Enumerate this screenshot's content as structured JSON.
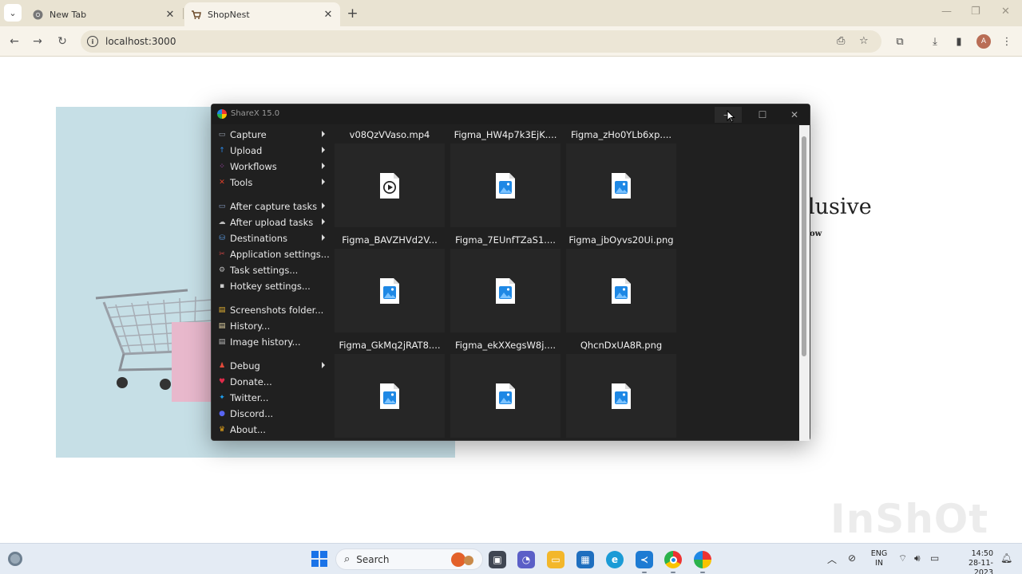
{
  "browser": {
    "tabs": [
      {
        "title": "New Tab",
        "icon": "chrome-icon"
      },
      {
        "title": "ShopNest",
        "icon": "shopnest-favicon",
        "active": true
      }
    ],
    "url": "localhost:3000",
    "avatar_letter": "A"
  },
  "page": {
    "heading_partial": "lusive",
    "subheading_partial": "ow",
    "watermark": "InShOt"
  },
  "sharex": {
    "title": "ShareX 15.0",
    "menu": [
      {
        "label": "Capture",
        "icon": "capture-icon",
        "submenu": true
      },
      {
        "label": "Upload",
        "icon": "upload-icon",
        "submenu": true
      },
      {
        "label": "Workflows",
        "icon": "workflows-icon",
        "submenu": true
      },
      {
        "label": "Tools",
        "icon": "tools-icon",
        "submenu": true
      },
      {
        "label": "After capture tasks",
        "icon": "after-capture-icon",
        "submenu": true
      },
      {
        "label": "After upload tasks",
        "icon": "after-upload-icon",
        "submenu": true
      },
      {
        "label": "Destinations",
        "icon": "destinations-icon",
        "submenu": true
      },
      {
        "label": "Application settings...",
        "icon": "app-settings-icon",
        "submenu": false
      },
      {
        "label": "Task settings...",
        "icon": "task-settings-icon",
        "submenu": false
      },
      {
        "label": "Hotkey settings...",
        "icon": "hotkey-settings-icon",
        "submenu": false
      },
      {
        "label": "Screenshots folder...",
        "icon": "folder-icon",
        "submenu": false
      },
      {
        "label": "History...",
        "icon": "history-icon",
        "submenu": false
      },
      {
        "label": "Image history...",
        "icon": "image-history-icon",
        "submenu": false
      },
      {
        "label": "Debug",
        "icon": "debug-icon",
        "submenu": true
      },
      {
        "label": "Donate...",
        "icon": "heart-icon",
        "submenu": false
      },
      {
        "label": "Twitter...",
        "icon": "twitter-icon",
        "submenu": false
      },
      {
        "label": "Discord...",
        "icon": "discord-icon",
        "submenu": false
      },
      {
        "label": "About...",
        "icon": "crown-icon",
        "submenu": false
      }
    ],
    "files": [
      {
        "name": "v08QzVVaso.mp4",
        "type": "video"
      },
      {
        "name": "Figma_HW4p7k3EjK....",
        "type": "image"
      },
      {
        "name": "Figma_zHo0YLb6xp....",
        "type": "image"
      },
      {
        "name": "Figma_BAVZHVd2V...",
        "type": "image"
      },
      {
        "name": "Figma_7EUnfTZaS1....",
        "type": "image"
      },
      {
        "name": "Figma_jbOyvs20Ui.png",
        "type": "image"
      },
      {
        "name": "Figma_GkMq2jRAT8....",
        "type": "image"
      },
      {
        "name": "Figma_ekXXegsW8j....",
        "type": "image"
      },
      {
        "name": "QhcnDxUA8R.png",
        "type": "image"
      }
    ]
  },
  "taskbar": {
    "search_placeholder": "Search",
    "lang_line1": "ENG",
    "lang_line2": "IN",
    "time": "14:50",
    "date": "28-11-2023"
  }
}
